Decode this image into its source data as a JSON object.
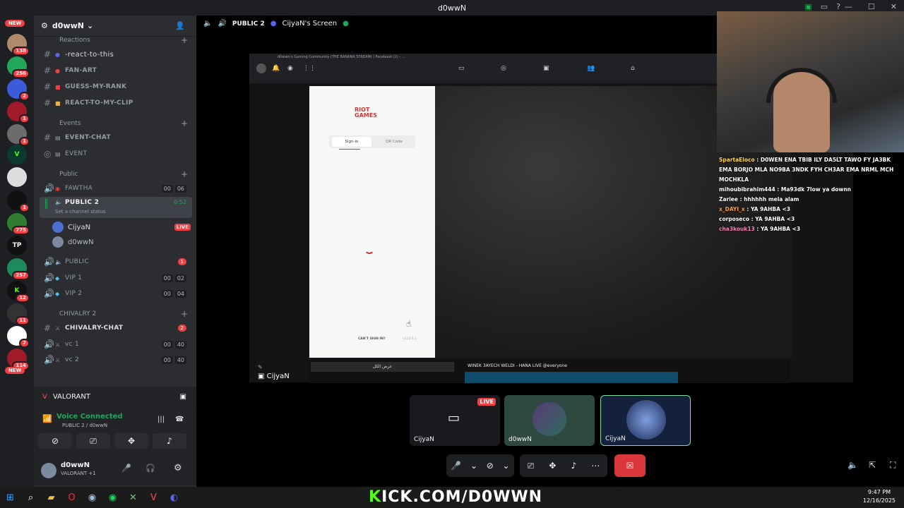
{
  "window": {
    "title": "d0wwN"
  },
  "rail": {
    "new_label": "NEW",
    "servers": [
      {
        "badge": "138"
      },
      {
        "badge": "256"
      },
      {
        "badge": "2"
      },
      {
        "badge": "1"
      },
      {
        "badge": "1"
      },
      {
        "badge": ""
      },
      {
        "badge": ""
      },
      {
        "badge": "1"
      },
      {
        "badge": "775"
      },
      {
        "badge": ""
      },
      {
        "badge": "257"
      },
      {
        "badge": "12"
      },
      {
        "badge": "11"
      },
      {
        "badge": "7"
      },
      {
        "badge": "114"
      }
    ],
    "new_label_bottom": "NEW"
  },
  "guild": {
    "name": "d0wwN"
  },
  "channels": {
    "cat_reactions": "Reactions",
    "react_to_this": "-react-to-this",
    "fan_art": "FAN-ART",
    "guess_my_rank": "GUESS-MY-RANK",
    "react_to_my_clip": "REACT-TO-MY-CLIP",
    "cat_events": "Events",
    "event_chat": "EVENT-CHAT",
    "event": "EVENT",
    "cat_public": "Public",
    "fawtha": "FAWTHA",
    "fawtha_c1": "00",
    "fawtha_c2": "06",
    "public2": "PUBLIC 2",
    "public2_time": "0:52",
    "public2_status": "Set a channel status",
    "user1": "CijyaN",
    "user1_live": "LIVE",
    "user2": "d0wwN",
    "public": "PUBLIC",
    "public_count": "1",
    "vip1": "VIP 1",
    "vip1_c1": "00",
    "vip1_c2": "02",
    "vip2": "VIP 2",
    "vip2_c1": "00",
    "vip2_c2": "04",
    "cat_chivalry": "CHIVALRY 2",
    "chivalry_chat": "CHIVALRY-CHAT",
    "chivalry_count": "2",
    "vc1": "vc 1",
    "vc1_c1": "00",
    "vc1_c2": "40",
    "vc2": "vc 2",
    "vc2_c1": "00",
    "vc2_c2": "40"
  },
  "activity": {
    "game": "VALORANT"
  },
  "voice": {
    "status": "Voice Connected",
    "location": "PUBLIC 2 / d0wwN"
  },
  "user": {
    "name": "d0wwN",
    "activity": "VALORANT +1"
  },
  "stage": {
    "channel": "PUBLIC 2",
    "screen_title": "CijyaN's Screen"
  },
  "browser": {
    "tab_title": "d0wwn's Gaming Community (THE BANANA STREAM) | Facebook (1) - ..."
  },
  "riot": {
    "brand_line1": "RIOT",
    "brand_line2": "GAMES",
    "tab_signin": "Sign-in",
    "tab_qr": "QR Code",
    "cant_sign_in": "CAN'T SIGN IN?",
    "version": "v123.0.1"
  },
  "overlay": {
    "see_all": "عرض الكل",
    "notification": "WINEK 3AYECH WELDI - HANA LIVE @everyone",
    "presenter": "CijyaN"
  },
  "stream_chat": [
    {
      "user": "SpartaEloco",
      "color": "#ffd84a",
      "msg": "D0WEN ENA TBIB ILY DA5LT TAWO FY JA3BK EMA BORJO MLA NO9BA 3NDK FYH CH3AR EMA NRML MCH MOCHKLA"
    },
    {
      "user": "mihoubibrahim444",
      "color": "#ffffff",
      "msg": "Ma93dk 7low ya downn"
    },
    {
      "user": "Zariee",
      "color": "#ffffff",
      "msg": "hhhhhh mela alam"
    },
    {
      "user": "x_DAYI_x",
      "color": "#ff9b3d",
      "msg": "YA 9AHBA <3"
    },
    {
      "user": "corposeco",
      "color": "#ffffff",
      "msg": "YA 9AHBA <3"
    },
    {
      "user": "cha3kouk13",
      "color": "#ff7eb6",
      "msg": "YA 9AHBA <3"
    }
  ],
  "tiles": [
    {
      "label": "CijyaN",
      "live": "LIVE"
    },
    {
      "label": "d0wwN"
    },
    {
      "label": "CijyaN"
    }
  ],
  "branding": {
    "kick_prefix": "K",
    "kick_rest": "ICK.COM/D0WWN"
  },
  "clock": {
    "time": "9:47 PM",
    "date": "12/16/2025"
  }
}
